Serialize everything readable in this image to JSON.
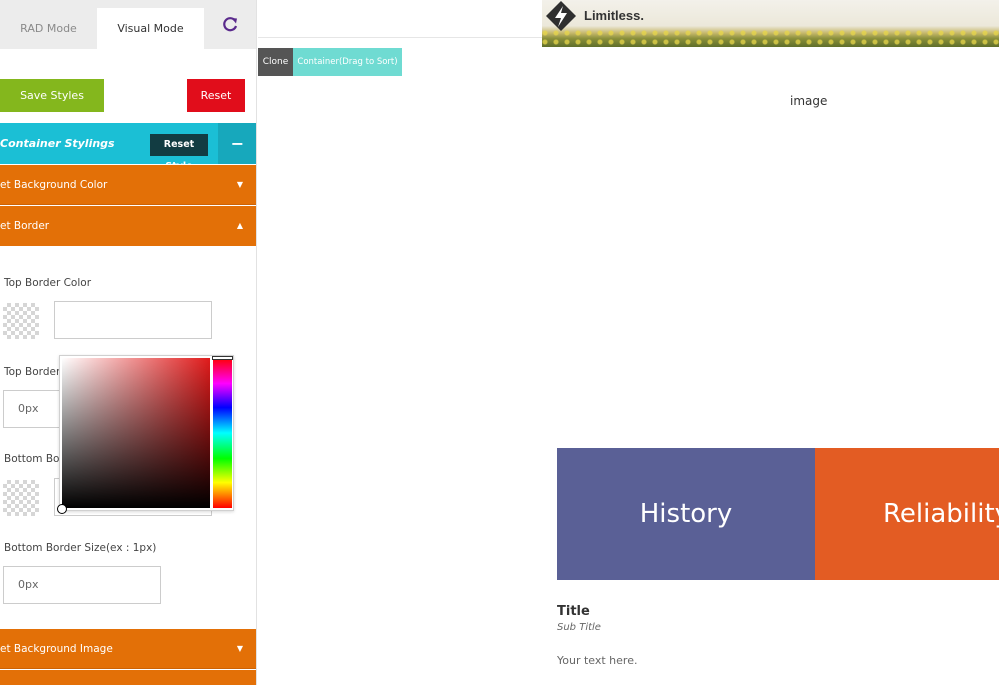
{
  "panel": {
    "tabs": [
      {
        "label": "RAD Mode",
        "active": false
      },
      {
        "label": "Visual Mode",
        "active": true
      }
    ],
    "refresh_icon": "refresh-icon",
    "buttons": {
      "save": "Save Styles",
      "reset": "Reset"
    },
    "section": {
      "title": "Container Stylings",
      "reset_style": "Reset Style",
      "collapse_symbol": "−"
    },
    "accordions": {
      "background_color": "et Background Color",
      "border": "et Border",
      "background_image": "et Background Image"
    },
    "fields": {
      "top_border_color": {
        "label": "Top Border Color",
        "value": ""
      },
      "top_border_size": {
        "label": "Top Border",
        "value": "0px"
      },
      "bottom_border_color": {
        "label": "Bottom Bor",
        "value": ""
      },
      "bottom_border_size": {
        "label": "Bottom Border Size(ex : 1px)",
        "value": "0px"
      }
    },
    "colors": {
      "save": "#84b71d",
      "reset": "#e10d1b",
      "section": "#1bbfd5",
      "accordion": "#e37007",
      "picker_hue": "#e01b1b"
    }
  },
  "canvas": {
    "logo_text": "Limitless.",
    "toolbar": {
      "clone": "Clone",
      "drag": "Container(Drag to Sort)"
    },
    "image_label": "image",
    "tiles": [
      {
        "label": "History",
        "color": "#5a6096"
      },
      {
        "label": "Reliability",
        "color": "#e35c23"
      }
    ],
    "card": {
      "title": "Title",
      "subtitle": "Sub Title",
      "text": "Your text here."
    }
  }
}
